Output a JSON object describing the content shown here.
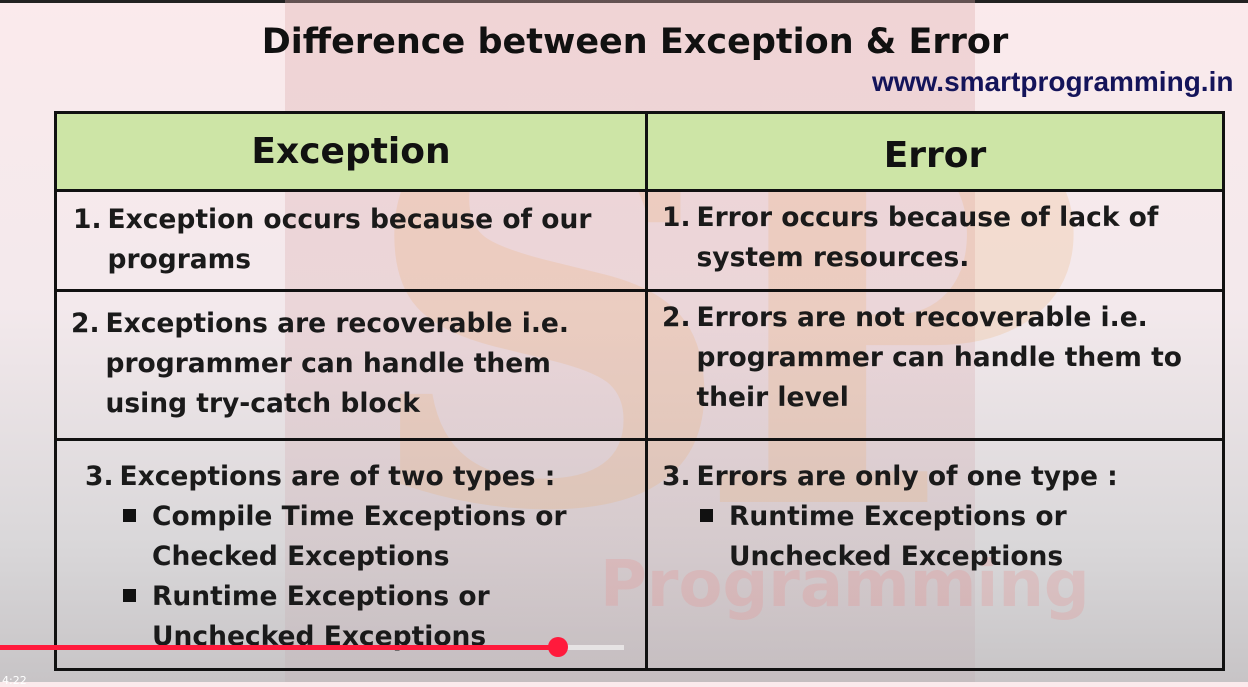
{
  "slide": {
    "title": "Difference between Exception & Error",
    "website": "www.smartprogramming.in",
    "watermark_text": "Programming"
  },
  "table": {
    "headers": [
      "Exception",
      "Error"
    ],
    "rows": [
      {
        "exception": {
          "num": "1.",
          "text": "Exception occurs because of our programs"
        },
        "error": {
          "num": "1.",
          "text": "Error occurs because of lack of system resources."
        }
      },
      {
        "exception": {
          "num": "2.",
          "text": "Exceptions are recoverable i.e. programmer can handle them using try-catch block"
        },
        "error": {
          "num": "2.",
          "text": "Errors are not recoverable i.e. programmer can handle them to their level"
        }
      },
      {
        "exception": {
          "num": "3.",
          "text": "Exceptions are of two types :",
          "bullets": [
            "Compile Time Exceptions or Checked Exceptions",
            "Runtime Exceptions or Unchecked Exceptions"
          ]
        },
        "error": {
          "num": "3.",
          "text": "Errors are only of one type :",
          "bullets": [
            "Runtime Exceptions or Unchecked Exceptions"
          ]
        }
      }
    ]
  },
  "player": {
    "progress": 0.447,
    "time": "4:22"
  },
  "colors": {
    "header_bg": "#cde5a6",
    "site_text": "#14145a",
    "progress": "#ff1a3c"
  }
}
